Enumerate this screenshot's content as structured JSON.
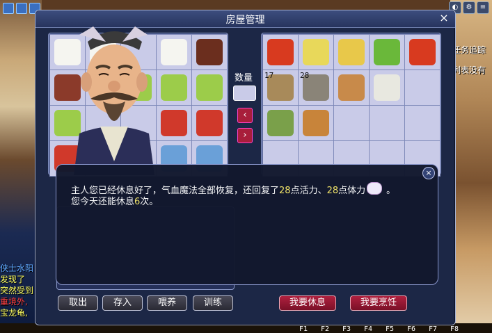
{
  "window": {
    "title": "房屋管理",
    "close_icon": "×"
  },
  "quantity": {
    "label": "数量",
    "value": ""
  },
  "left_grid": {
    "items": [
      {
        "name": "rice-dumpling-plate",
        "color": "#f5f5f0"
      },
      {
        "name": "rice-dumpling-plate",
        "color": "#f5f5f0"
      },
      {
        "name": "empty",
        "color": ""
      },
      {
        "name": "rice-dumpling-plate",
        "color": "#f5f5f0"
      },
      {
        "name": "meat-plate",
        "color": "#6b2e1e"
      },
      {
        "name": "meat-dish",
        "color": "#8b3a2a"
      },
      {
        "name": "empty",
        "color": ""
      },
      {
        "name": "green-cake-box",
        "color": "#9ccc4a"
      },
      {
        "name": "green-cake-box",
        "color": "#9ccc4a"
      },
      {
        "name": "green-cake-box",
        "color": "#9ccc4a"
      },
      {
        "name": "green-cake-box",
        "color": "#9ccc4a"
      },
      {
        "name": "empty",
        "color": ""
      },
      {
        "name": "empty",
        "color": ""
      },
      {
        "name": "red-pouch",
        "color": "#d0392b"
      },
      {
        "name": "red-pouch",
        "color": "#d0392b"
      },
      {
        "name": "red-pouch",
        "color": "#d0392b"
      },
      {
        "name": "empty",
        "color": ""
      },
      {
        "name": "empty",
        "color": ""
      },
      {
        "name": "blue-vase",
        "color": "#6aa0d8"
      },
      {
        "name": "blue-vase",
        "color": "#6aa0d8"
      }
    ]
  },
  "right_grid": {
    "items": [
      {
        "name": "red-fan",
        "color": "#d83a1f",
        "count": ""
      },
      {
        "name": "yellow-fan",
        "color": "#e8d85a",
        "count": ""
      },
      {
        "name": "yellow-fan",
        "color": "#e8c84a",
        "count": ""
      },
      {
        "name": "green-fan",
        "color": "#6ab83a",
        "count": ""
      },
      {
        "name": "red-fan",
        "color": "#d83a1f",
        "count": ""
      },
      {
        "name": "book-bundle",
        "color": "#a88a5a",
        "count": "17"
      },
      {
        "name": "stone-disc",
        "color": "#8a8478",
        "count": "28"
      },
      {
        "name": "rice-bowl",
        "color": "#c88a4a",
        "count": ""
      },
      {
        "name": "ticket",
        "color": "#e8e8e0",
        "count": ""
      },
      {
        "name": "empty",
        "color": "",
        "count": ""
      },
      {
        "name": "green-sack",
        "color": "#7aa04a",
        "count": ""
      },
      {
        "name": "bronze-key",
        "color": "#c8843a",
        "count": ""
      },
      {
        "name": "empty",
        "color": "",
        "count": ""
      },
      {
        "name": "empty",
        "color": "",
        "count": ""
      },
      {
        "name": "empty",
        "color": "",
        "count": ""
      },
      {
        "name": "empty",
        "color": "",
        "count": ""
      },
      {
        "name": "empty",
        "color": "",
        "count": ""
      },
      {
        "name": "empty",
        "color": "",
        "count": ""
      },
      {
        "name": "empty",
        "color": "",
        "count": ""
      },
      {
        "name": "empty",
        "color": "",
        "count": ""
      }
    ]
  },
  "dialog": {
    "line1_a": "主人您已经休息好了，气血魔法全部恢复，还回复了",
    "line1_num1": "28",
    "line1_b": "点活力、",
    "line1_num2": "28",
    "line1_c": "点体力",
    "line1_end": "。",
    "line2_a": "您今天还能休息",
    "line2_num": "6",
    "line2_b": "次。",
    "close_icon": "×"
  },
  "buttons": {
    "take_out": "取出",
    "deposit": "存入",
    "feed": "喂养",
    "train": "训练",
    "rest": "我要休息",
    "cook": "我要烹饪"
  },
  "background": {
    "task_tracking": "任务追踪",
    "list_not_have": "列表没有",
    "chat_lines": [
      {
        "text": "侠士水阳",
        "color": "#5fa8ff"
      },
      {
        "text": "发现了",
        "color": "#ffff60"
      },
      {
        "text": "突然受到",
        "color": "#ffff60"
      },
      {
        "text": "重境外,",
        "color": "#ff4040"
      },
      {
        "text": "宝龙龟,",
        "color": "#ffff60"
      }
    ],
    "fkeys": [
      "F1",
      "F2",
      "F3",
      "F4",
      "F5",
      "F6",
      "F7",
      "F8"
    ]
  },
  "colors": {
    "accent_red": "#a81e3b",
    "highlight_yellow": "#f6e86a",
    "window_bg": "#1c2746"
  }
}
